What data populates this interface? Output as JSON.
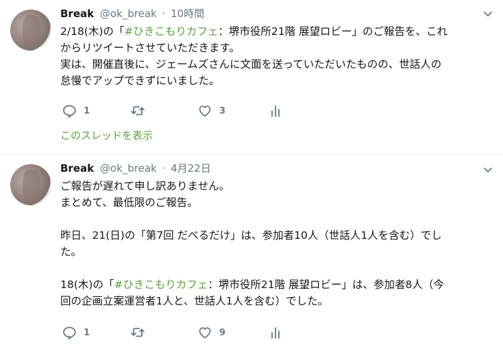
{
  "tweets": [
    {
      "name": "Break",
      "handle": "@ok_break",
      "separator": "·",
      "time": "10時間",
      "lines": [
        [
          {
            "text": "2/18(木)の「"
          },
          {
            "text": "#ひきこもりカフェ",
            "hashtag": true
          },
          {
            "text": "：堺市役所21階 展望ロビー」のご報告を、これ"
          }
        ],
        [
          {
            "text": "からリツイートさせていただきます。"
          }
        ],
        [
          {
            "text": "実は、開催直後に、ジェームズさんに文面を送っていただいたものの、世話人の"
          }
        ],
        [
          {
            "text": "怠慢でアップできずにいました。"
          }
        ]
      ],
      "actions": {
        "reply_count": "1",
        "retweet_count": "",
        "like_count": "3"
      },
      "thread_link": "このスレッドを表示"
    },
    {
      "name": "Break",
      "handle": "@ok_break",
      "separator": "·",
      "time": "4月22日",
      "lines": [
        [
          {
            "text": "ご報告が遅れて申し訳ありません。"
          }
        ],
        [
          {
            "text": "まとめて、最低限のご報告。"
          }
        ],
        [],
        [
          {
            "text": "昨日、21(日)の「第7回 だべるだけ」は、参加者10人（世話人1人を含む）でし"
          }
        ],
        [
          {
            "text": "た。"
          }
        ],
        [],
        [
          {
            "text": "18(木)の「"
          },
          {
            "text": "#ひきこもりカフェ",
            "hashtag": true
          },
          {
            "text": "：堺市役所21階 展望ロビー」は、参加者8人（今"
          }
        ],
        [
          {
            "text": "回の企画立案運営者1人と、世話人1人を含む）でした。"
          }
        ]
      ],
      "actions": {
        "reply_count": "1",
        "retweet_count": "",
        "like_count": "9"
      }
    }
  ],
  "colors": {
    "link_green": "#59a33c",
    "muted_gray": "#657786",
    "text": "#14171a",
    "divider": "#e6ecf0"
  },
  "icons": [
    "chevron-down-icon",
    "reply-icon",
    "retweet-icon",
    "like-icon",
    "analytics-icon"
  ]
}
